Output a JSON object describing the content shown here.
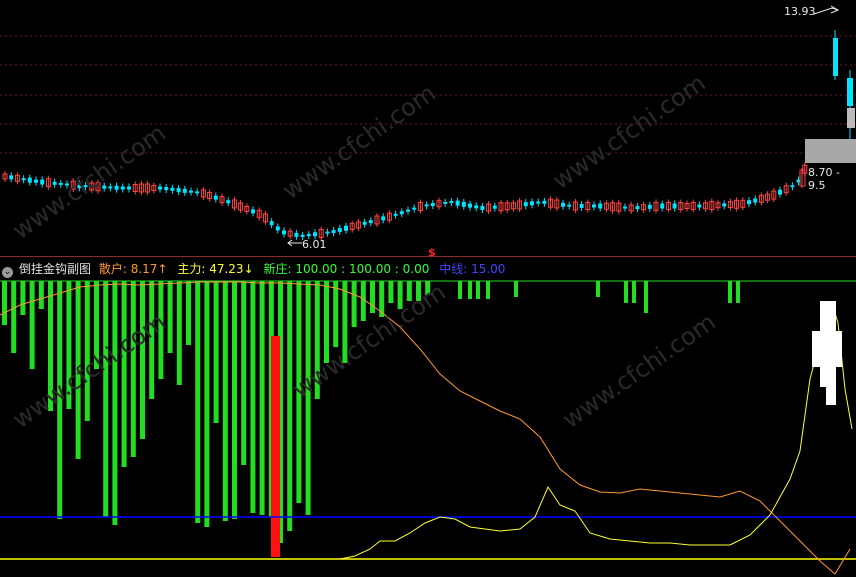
{
  "main_chart": {
    "high_label": "13.93",
    "low_label": "6.01",
    "range_label": "8.70 - 9.5",
    "signal_marker": "$",
    "colors": {
      "up": "#ff4444",
      "down": "#00e5ff",
      "grid": "#6b1a1a",
      "range_box": "#aaaaaa"
    }
  },
  "indicator": {
    "title": "倒挂金钩副图",
    "sanhu_label": "散户:",
    "sanhu_value": "8.17",
    "sanhu_arrow": "↑",
    "zhuli_label": "主力:",
    "zhuli_value": "47.23",
    "zhuli_arrow": "↓",
    "xinzhuang_label": "新庄:",
    "xinzhuang_value": "100.00 : 100.00 : 0.00",
    "zhongxian_label": "中线:",
    "zhongxian_value": "15.00",
    "colors": {
      "sanhu": "#ff9933",
      "zhuli": "#ffff33",
      "xinzhuang": "#33ff33",
      "zhongxian": "#3333ff",
      "bars": "#22dd22",
      "red_bar": "#ff1111",
      "yellow_line": "#ffff00",
      "blue_line": "#0000ff"
    }
  },
  "watermark": "www.cfchi.com"
}
